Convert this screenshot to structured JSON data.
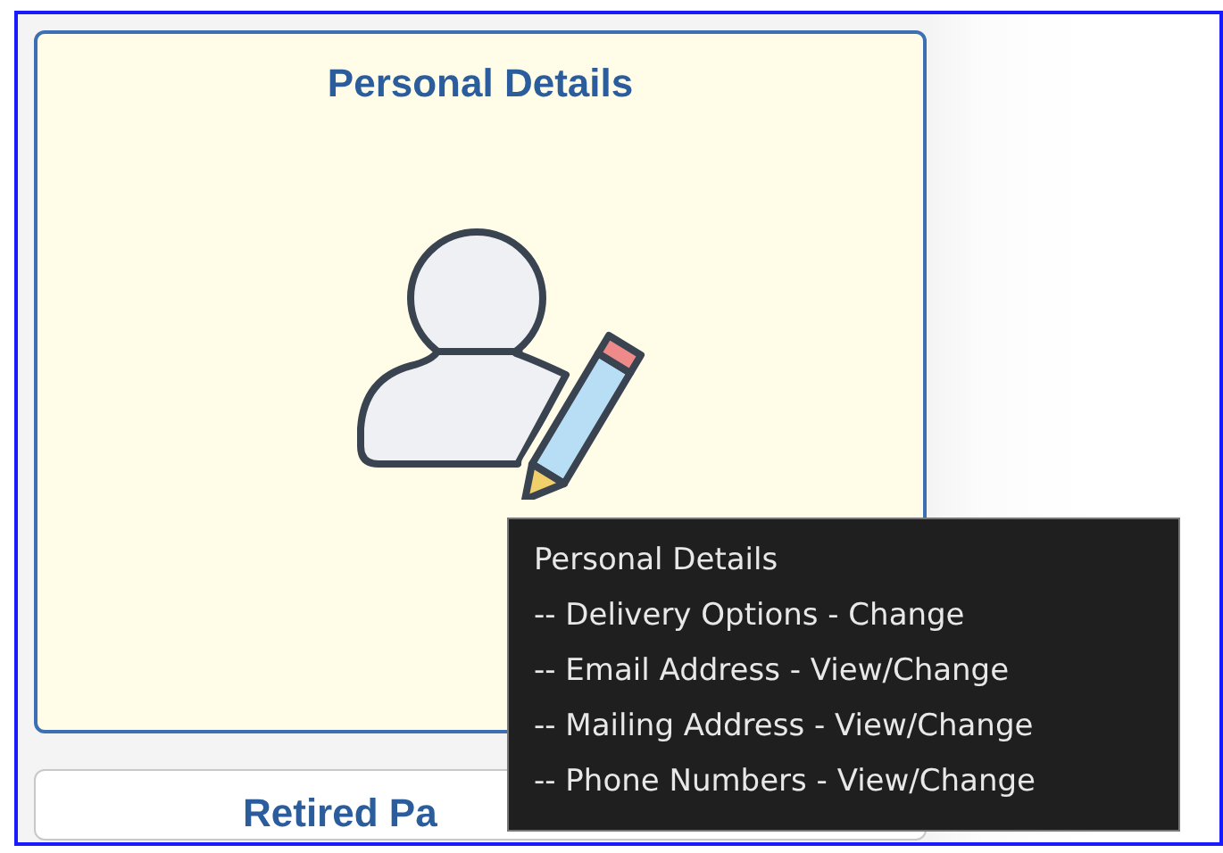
{
  "cards": [
    {
      "title": "Personal Details",
      "highlighted": true
    },
    {
      "title": "Retired Pa",
      "highlighted": false
    }
  ],
  "tooltip": {
    "title": "Personal Details",
    "lines": [
      "-- Delivery Options - Change",
      "-- Email Address - View/Change",
      "-- Mailing Address - View/Change",
      "-- Phone Numbers - View/Change"
    ]
  }
}
